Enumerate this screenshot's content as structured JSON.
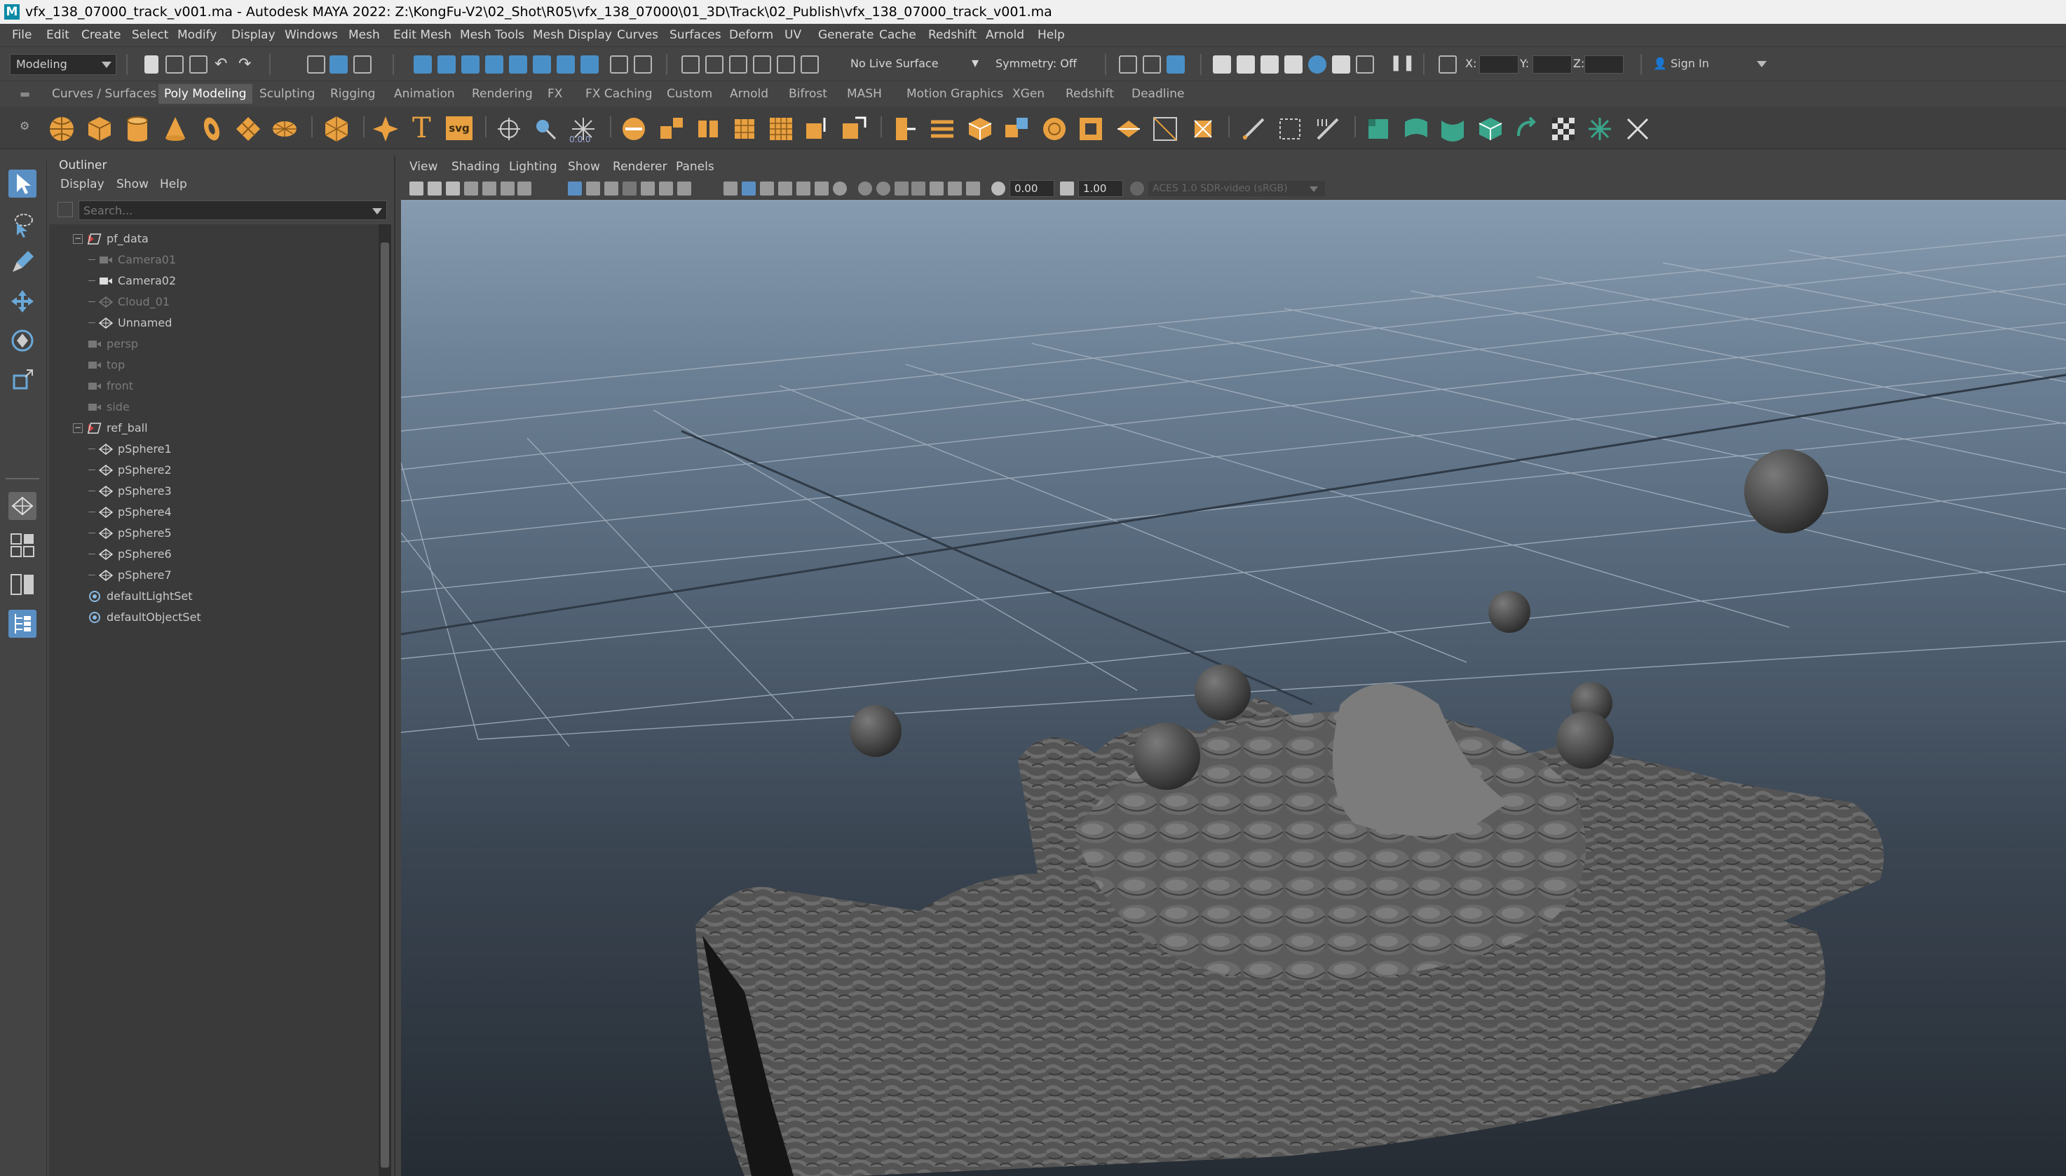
{
  "window": {
    "title": "vfx_138_07000_track_v001.ma - Autodesk MAYA 2022: Z:\\KongFu-V2\\02_Shot\\R05\\vfx_138_07000\\01_3D\\Track\\02_Publish\\vfx_138_07000_track_v001.ma",
    "logo_letter": "M"
  },
  "menubar": [
    "File",
    "Edit",
    "Create",
    "Select",
    "Modify",
    "Display",
    "Windows",
    "Mesh",
    "Edit Mesh",
    "Mesh Tools",
    "Mesh Display",
    "Curves",
    "Surfaces",
    "Deform",
    "UV",
    "Generate",
    "Cache",
    "Redshift",
    "Arnold",
    "Help"
  ],
  "statusline": {
    "menuset": "Modeling",
    "live_surface": "No Live Surface",
    "symmetry": "Symmetry: Off",
    "x_label": "X:",
    "y_label": "Y:",
    "z_label": "Z:",
    "sign_in": "Sign In"
  },
  "shelf_tabs": [
    "Curves / Surfaces",
    "Poly Modeling",
    "Sculpting",
    "Rigging",
    "Animation",
    "Rendering",
    "FX",
    "FX Caching",
    "Custom",
    "Arnold",
    "Bifrost",
    "MASH",
    "Motion Graphics",
    "XGen",
    "Redshift",
    "Deadline"
  ],
  "shelf_active": "Poly Modeling",
  "shelf_text_icons": {
    "text_tool": "T",
    "svg_tool": "svg",
    "value_readout": "0.0.0"
  },
  "outliner": {
    "title": "Outliner",
    "menu": [
      "Display",
      "Show",
      "Help"
    ],
    "search_placeholder": "Search...",
    "items": [
      {
        "label": "pf_data"
      },
      {
        "label": "Camera01"
      },
      {
        "label": "Camera02"
      },
      {
        "label": "Cloud_01"
      },
      {
        "label": "Unnamed"
      },
      {
        "label": "persp"
      },
      {
        "label": "top"
      },
      {
        "label": "front"
      },
      {
        "label": "side"
      },
      {
        "label": "ref_ball"
      },
      {
        "label": "pSphere1"
      },
      {
        "label": "pSphere2"
      },
      {
        "label": "pSphere3"
      },
      {
        "label": "pSphere4"
      },
      {
        "label": "pSphere5"
      },
      {
        "label": "pSphere6"
      },
      {
        "label": "pSphere7"
      },
      {
        "label": "defaultLightSet"
      },
      {
        "label": "defaultObjectSet"
      }
    ]
  },
  "viewport": {
    "menu": [
      "View",
      "Shading",
      "Lighting",
      "Show",
      "Renderer",
      "Panels"
    ],
    "exposure": "0.00",
    "gamma": "1.00",
    "color_space": "ACES 1.0 SDR-video (sRGB)"
  },
  "colors": {
    "accent_blue": "#4a90c8",
    "shelf_orange": "#e8a040",
    "shelf_teal": "#3aa58a"
  }
}
